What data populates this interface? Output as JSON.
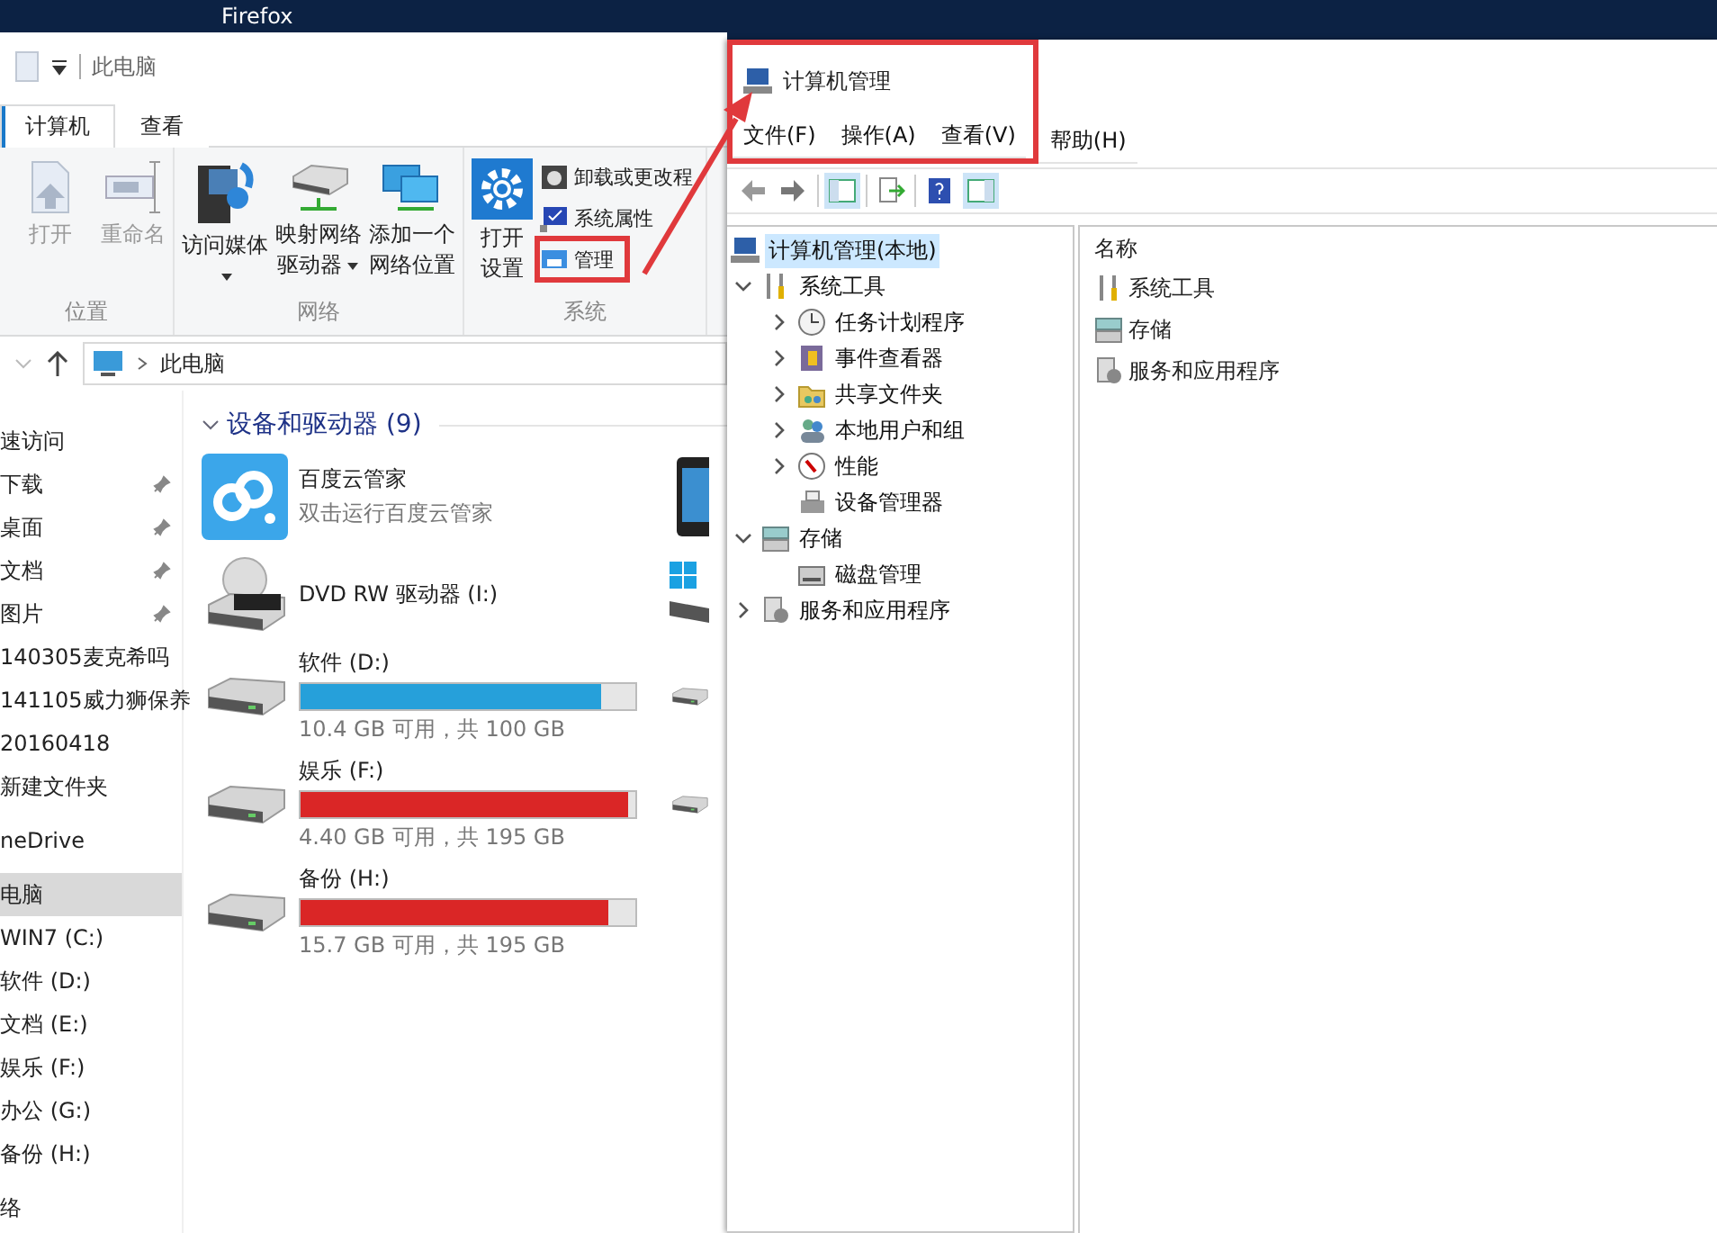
{
  "desktop": {
    "title": "Firefox"
  },
  "explorer": {
    "title": "此电脑",
    "tabs": [
      {
        "label": "计算机",
        "selected": true
      },
      {
        "label": "查看",
        "selected": false
      }
    ],
    "ribbon_groups": [
      {
        "label": "位置",
        "items": [
          {
            "kind": "open",
            "label": "打开",
            "disabled": true,
            "dropdown": false
          },
          {
            "kind": "rename",
            "label": "重命名",
            "disabled": true,
            "dropdown": false
          }
        ]
      },
      {
        "label": "网络",
        "items": [
          {
            "kind": "media",
            "label": "访问媒体",
            "disabled": false,
            "dropdown": true
          },
          {
            "kind": "map-drive",
            "label": "映射网络驱动器",
            "disabled": false,
            "dropdown": true
          },
          {
            "kind": "net-location",
            "label": "添加一个网络位置",
            "disabled": false,
            "dropdown": false
          }
        ]
      },
      {
        "label": "系统",
        "items": [
          {
            "kind": "settings",
            "label": "打开设置",
            "disabled": false,
            "dropdown": false
          }
        ],
        "small_items": [
          {
            "kind": "uninstall",
            "label": "卸载或更改程",
            "highlighted": false
          },
          {
            "kind": "properties",
            "label": "系统属性",
            "highlighted": false
          },
          {
            "kind": "manage",
            "label": "管理",
            "highlighted": true
          }
        ]
      }
    ],
    "address": "此电脑",
    "nav": [
      {
        "kind": "header",
        "label": "速访问",
        "pinned": false,
        "selected": false
      },
      {
        "kind": "item",
        "label": "下载",
        "pinned": true,
        "selected": false
      },
      {
        "kind": "item",
        "label": "桌面",
        "pinned": true,
        "selected": false
      },
      {
        "kind": "item",
        "label": "文档",
        "pinned": true,
        "selected": false
      },
      {
        "kind": "item",
        "label": "图片",
        "pinned": true,
        "selected": false
      },
      {
        "kind": "item",
        "label": "140305麦克希吗",
        "pinned": false,
        "selected": false
      },
      {
        "kind": "item",
        "label": "141105威力狮保养",
        "pinned": false,
        "selected": false
      },
      {
        "kind": "item",
        "label": "20160418",
        "pinned": false,
        "selected": false
      },
      {
        "kind": "item",
        "label": "新建文件夹",
        "pinned": false,
        "selected": false
      },
      {
        "kind": "header",
        "label": "neDrive",
        "pinned": false,
        "selected": false
      },
      {
        "kind": "header",
        "label": "电脑",
        "pinned": false,
        "selected": true
      },
      {
        "kind": "item",
        "label": "WIN7 (C:)",
        "pinned": false,
        "selected": false
      },
      {
        "kind": "item",
        "label": "软件 (D:)",
        "pinned": false,
        "selected": false
      },
      {
        "kind": "item",
        "label": "文档 (E:)",
        "pinned": false,
        "selected": false
      },
      {
        "kind": "item",
        "label": "娱乐 (F:)",
        "pinned": false,
        "selected": false
      },
      {
        "kind": "item",
        "label": "办公 (G:)",
        "pinned": false,
        "selected": false
      },
      {
        "kind": "item",
        "label": "备份 (H:)",
        "pinned": false,
        "selected": false
      },
      {
        "kind": "header",
        "label": "络",
        "pinned": false,
        "selected": false
      }
    ],
    "section": "设备和驱动器 (9)",
    "devices": [
      {
        "kind": "app",
        "name": "百度云管家",
        "subtitle": "双击运行百度云管家",
        "neighbor": {
          "kind": "phone"
        }
      },
      {
        "kind": "dvd",
        "name": "DVD RW 驱动器 (I:)",
        "neighbor": {
          "kind": "windows-drive"
        }
      },
      {
        "kind": "drive",
        "name": "软件 (D:)",
        "level": 0.896,
        "low_space": false,
        "reading": "10.4 GB 可用，共 100 GB",
        "neighbor": {
          "kind": "drive"
        }
      },
      {
        "kind": "drive",
        "name": "娱乐 (F:)",
        "level": 0.977,
        "low_space": true,
        "reading": "4.40 GB 可用，共 195 GB",
        "neighbor": {
          "kind": "drive"
        }
      },
      {
        "kind": "drive",
        "name": "备份 (H:)",
        "level": 0.92,
        "low_space": true,
        "reading": "15.7 GB 可用，共 195 GB"
      }
    ]
  },
  "computer_management": {
    "title": "计算机管理",
    "menu": [
      "文件(F)",
      "操作(A)",
      "查看(V)",
      "帮助(H)"
    ],
    "tree": [
      {
        "kind": "computer",
        "label": "计算机管理(本地)",
        "selected": true,
        "children": [
          {
            "kind": "tools",
            "label": "系统工具",
            "selected": false,
            "expanded": true,
            "children": [
              {
                "kind": "clock",
                "label": "任务计划程序",
                "selected": false,
                "expanded": false
              },
              {
                "kind": "event",
                "label": "事件查看器",
                "selected": false,
                "expanded": false
              },
              {
                "kind": "share",
                "label": "共享文件夹",
                "selected": false,
                "expanded": false
              },
              {
                "kind": "users",
                "label": "本地用户和组",
                "selected": false,
                "expanded": false
              },
              {
                "kind": "perf",
                "label": "性能",
                "selected": false,
                "expanded": false
              },
              {
                "kind": "device",
                "label": "设备管理器",
                "selected": false
              }
            ]
          },
          {
            "kind": "storage",
            "label": "存储",
            "selected": false,
            "expanded": true,
            "children": [
              {
                "kind": "disk",
                "label": "磁盘管理",
                "selected": false
              }
            ]
          },
          {
            "kind": "services",
            "label": "服务和应用程序",
            "selected": false,
            "expanded": false
          }
        ]
      }
    ],
    "column": "名称",
    "items": [
      {
        "kind": "tools",
        "label": "系统工具"
      },
      {
        "kind": "storage",
        "label": "存储"
      },
      {
        "kind": "services",
        "label": "服务和应用程序"
      }
    ]
  }
}
